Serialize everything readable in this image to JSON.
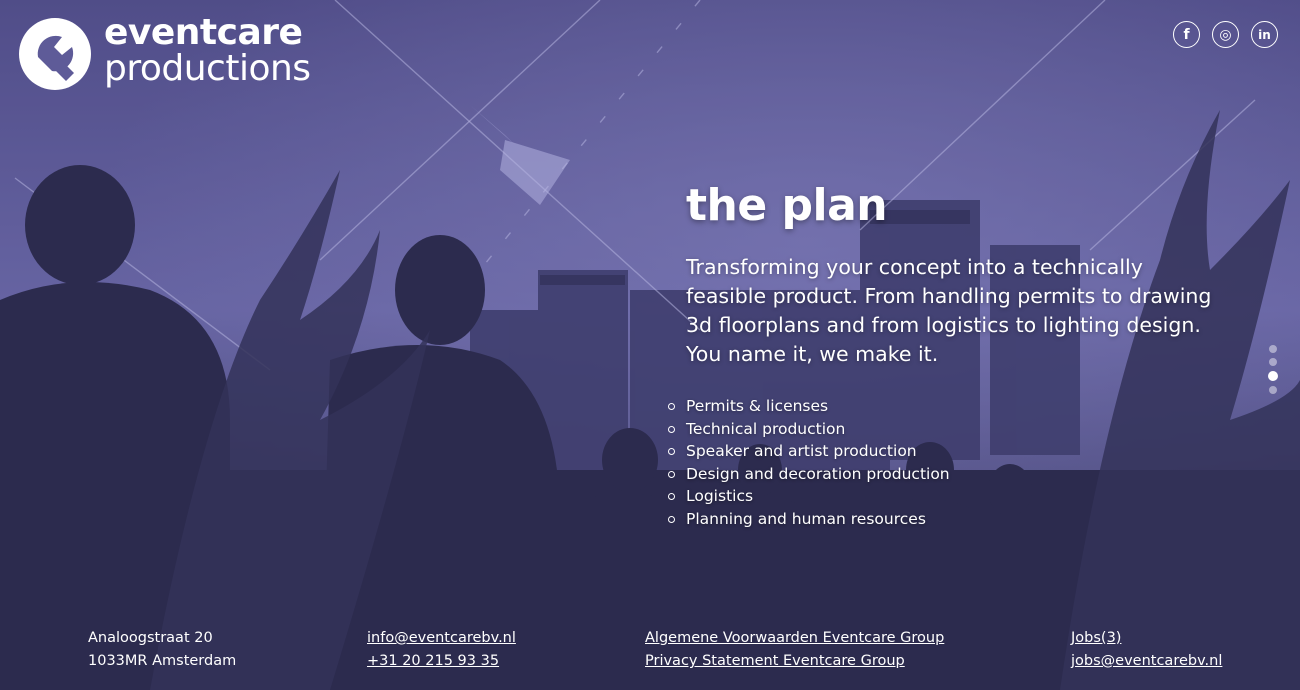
{
  "brand": {
    "name_line1": "eventcare",
    "name_line2": "productions"
  },
  "social": [
    {
      "name": "facebook",
      "glyph": "f"
    },
    {
      "name": "instagram",
      "glyph": "◎"
    },
    {
      "name": "linkedin",
      "glyph": "in"
    }
  ],
  "hero": {
    "title": "the plan",
    "description": "Transforming your concept into a technically feasible product. From handling permits to drawing 3d floorplans and from logistics to lighting design. You name it, we make it.",
    "services": [
      "Permits & licenses",
      "Technical production",
      "Speaker and artist production",
      "Design and decoration production",
      "Logistics",
      "Planning and human resources"
    ]
  },
  "pager": {
    "count": 4,
    "active_index": 2
  },
  "footer": {
    "address_line1": "Analoogstraat 20",
    "address_line2": "1033MR Amsterdam",
    "email": "info@eventcarebv.nl",
    "phone": "+31 20 215 93 35",
    "terms_link": "Algemene Voorwaarden Eventcare Group",
    "privacy_link": "Privacy Statement Eventcare Group",
    "jobs_link": "Jobs(3)",
    "jobs_email": "jobs@eventcarebv.nl"
  },
  "colors": {
    "overlay": "#5b5898",
    "text": "#ffffff"
  }
}
